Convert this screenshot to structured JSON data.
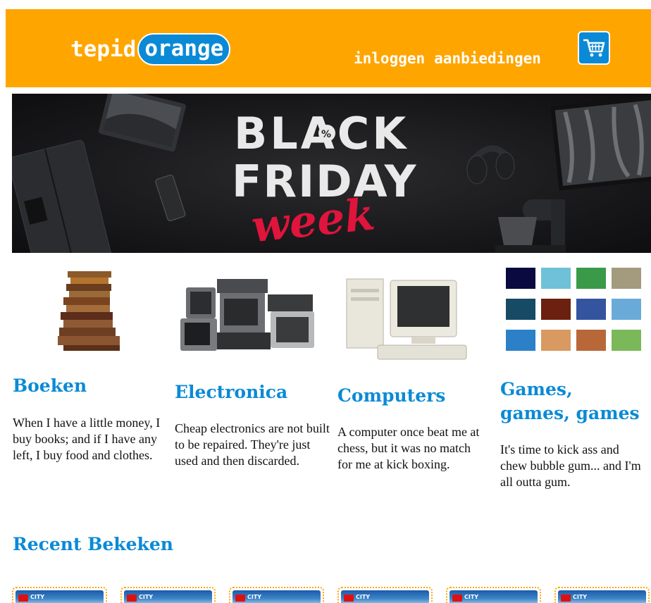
{
  "header": {
    "logo_left": "tepid",
    "logo_right": "orange",
    "nav": [
      {
        "label": "inloggen"
      },
      {
        "label": "aanbiedingen"
      }
    ],
    "cart_icon": "shopping-cart-icon"
  },
  "banner": {
    "line1": "BLACK",
    "line2": "FRIDAY",
    "line3": "week"
  },
  "categories": [
    {
      "title": "Boeken",
      "text": "When I have a little money, I buy books; and if I have any left, I buy food and clothes.",
      "image": "stacked-books"
    },
    {
      "title": "Electronica",
      "text": "Cheap electronics are not built to be repaired. They're just used and then discarded.",
      "image": "old-electronics-pile"
    },
    {
      "title": "Computers",
      "text": "A computer once beat me at chess, but it was no match for me at kick boxing.",
      "image": "retro-computer"
    },
    {
      "title": "Games, games, games",
      "text": "It's time to kick ass and chew bubble gum... and I'm all outta gum.",
      "image": "game-screenshots-grid"
    }
  ],
  "recent": {
    "title": "Recent Bekeken",
    "items": [
      {
        "label": "CITY"
      },
      {
        "label": "CITY"
      },
      {
        "label": "CITY"
      },
      {
        "label": "CITY"
      },
      {
        "label": "CITY"
      },
      {
        "label": "CITY"
      }
    ]
  }
}
